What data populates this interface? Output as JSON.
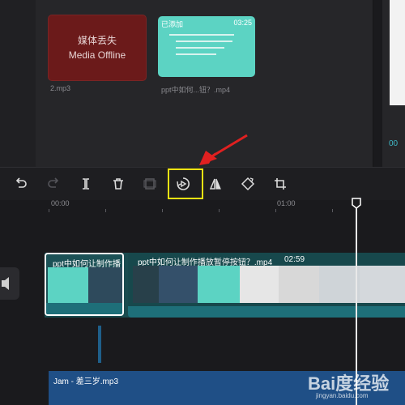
{
  "media": {
    "offline_line1": "媒体丢失",
    "offline_line2": "Media Offline",
    "file1_name": "2.mp3",
    "badge_added": "已添加",
    "thumb_duration": "03:25",
    "file2_name": "ppt中如何...钮？.mp4",
    "right_partial": "00"
  },
  "toolbar": {
    "icons": [
      "undo-icon",
      "redo-icon",
      "split-icon",
      "delete-icon",
      "freeze-icon",
      "reverse-play-icon",
      "mirror-icon",
      "rotate-icon",
      "crop-icon"
    ]
  },
  "ruler": {
    "label_start": "00:00",
    "label_mid": "01:00"
  },
  "track": {
    "clip1_title": "ppt中如何让制作播",
    "clip2_title": "ppt中如何让制作播放暂停按钮？.mp4",
    "clip2_duration": "02:59"
  },
  "audio": {
    "title": "Jam - 差三岁.mp3"
  },
  "watermark": {
    "brand": "Bai度经验",
    "url": "jingyan.baidu.com"
  },
  "colors": {
    "highlight": "#f2e313",
    "arrow": "#e02020",
    "offline_bg": "#6b1a1a",
    "clip_teal": "#5cd3c3"
  }
}
